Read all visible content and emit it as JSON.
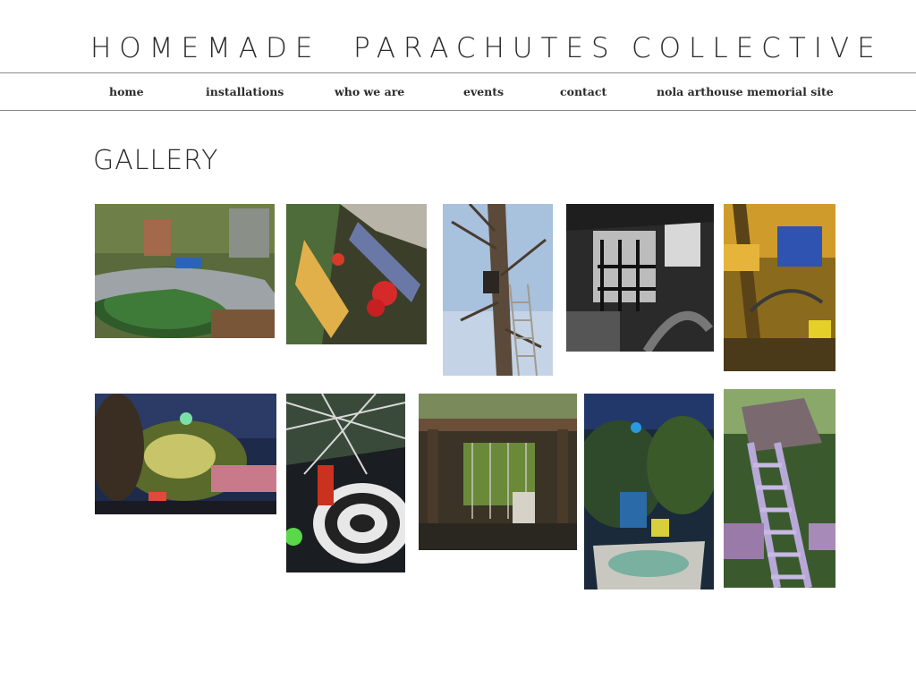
{
  "header": {
    "title_words": [
      "HOMEMADE",
      "PARACHUTES",
      "COLLECTIVE"
    ]
  },
  "nav": {
    "items": [
      {
        "label": "home"
      },
      {
        "label": "installations"
      },
      {
        "label": "who we are"
      },
      {
        "label": "events"
      },
      {
        "label": "contact"
      },
      {
        "label": "nola arthouse memorial site"
      }
    ]
  },
  "main": {
    "heading": "GALLERY",
    "photos": [
      {
        "subject": "pond-garden-photo"
      },
      {
        "subject": "red-ornaments-treehouse-photo"
      },
      {
        "subject": "tree-ladder-sky-photo"
      },
      {
        "subject": "black-white-spiral-stair-photo"
      },
      {
        "subject": "yellow-treehouse-interior-photo"
      },
      {
        "subject": "night-lights-garden-photo"
      },
      {
        "subject": "checkered-floor-night-photo"
      },
      {
        "subject": "overgrown-pavilion-photo"
      },
      {
        "subject": "night-pool-lights-photo"
      },
      {
        "subject": "purple-ladder-treehouse-photo"
      }
    ]
  },
  "colors": {
    "rule": "#8a8a8a",
    "text": "#2b2b2b"
  }
}
